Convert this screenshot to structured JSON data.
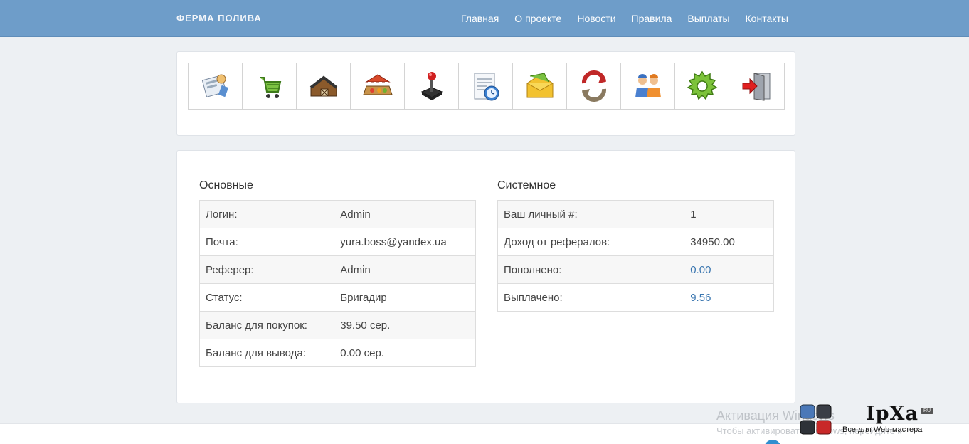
{
  "navbar": {
    "brand": "ФЕРМА ПОЛИВА",
    "links": [
      "Главная",
      "О проекте",
      "Новости",
      "Правила",
      "Выплаты",
      "Контакты"
    ]
  },
  "icons": [
    "profile-icon",
    "shopping-cart-icon",
    "barn-icon",
    "market-icon",
    "joystick-icon",
    "history-clock-icon",
    "mail-icon",
    "exchange-icon",
    "referrals-icon",
    "settings-gear-icon",
    "exit-door-icon"
  ],
  "main": {
    "title": "Основные",
    "rows": [
      {
        "label": "Логин:",
        "value": "Admin"
      },
      {
        "label": "Почта:",
        "value": "yura.boss@yandex.ua"
      },
      {
        "label": "Реферер:",
        "value": "Admin"
      },
      {
        "label": "Статус:",
        "value": "Бригадир"
      },
      {
        "label": "Баланс для покупок:",
        "value": "39.50 сер."
      },
      {
        "label": "Баланс для вывода:",
        "value": "0.00 сер."
      }
    ]
  },
  "system": {
    "title": "Системное",
    "rows": [
      {
        "label": "Ваш личный #:",
        "value": "1"
      },
      {
        "label": "Доход от рефералов:",
        "value": "34950.00"
      },
      {
        "label": "Пополнено:",
        "value": "0.00"
      },
      {
        "label": "Выплачено:",
        "value": "9.56"
      }
    ]
  },
  "watermark": {
    "activate_title": "Активация Windows",
    "activate_sub": "Чтобы активировать Windows, перейдите к",
    "ipxa_name": "IpXa",
    "ipxa_tld": "RU",
    "ipxa_tagline": "Все для Web-мастера"
  }
}
